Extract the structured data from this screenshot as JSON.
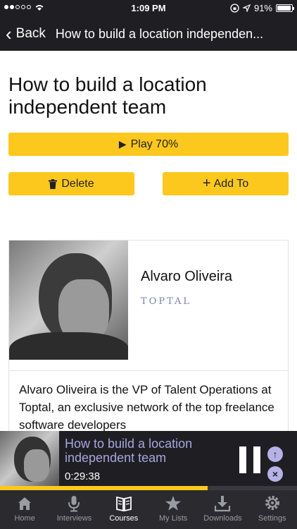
{
  "statusbar": {
    "time": "1:09 PM",
    "battery": "91%",
    "battery_level": 0.91
  },
  "nav": {
    "back_label": "Back",
    "title": "How to build a location independen..."
  },
  "page": {
    "title": "How to build a location independent team"
  },
  "actions": {
    "play_label": "Play 70%",
    "delete_label": "Delete",
    "add_label": "Add To"
  },
  "author": {
    "name": "Alvaro Oliveira",
    "company": "TOPTAL",
    "bio": "Alvaro Oliveira is the VP of Talent Operations at Toptal, an exclusive network of the top freelance software developers"
  },
  "player": {
    "title": "How to build a location independent team",
    "time": "0:29:38",
    "progress": 0.7
  },
  "tabs": [
    {
      "label": "Home",
      "icon": "home-icon"
    },
    {
      "label": "Interviews",
      "icon": "microphone-icon"
    },
    {
      "label": "Courses",
      "icon": "book-icon"
    },
    {
      "label": "My Lists",
      "icon": "star-icon"
    },
    {
      "label": "Downloads",
      "icon": "download-icon"
    },
    {
      "label": "Settings",
      "icon": "gear-icon"
    }
  ],
  "colors": {
    "accent": "#fcc81e",
    "bar": "#1f1e23",
    "player_title": "#a9a6dd"
  }
}
